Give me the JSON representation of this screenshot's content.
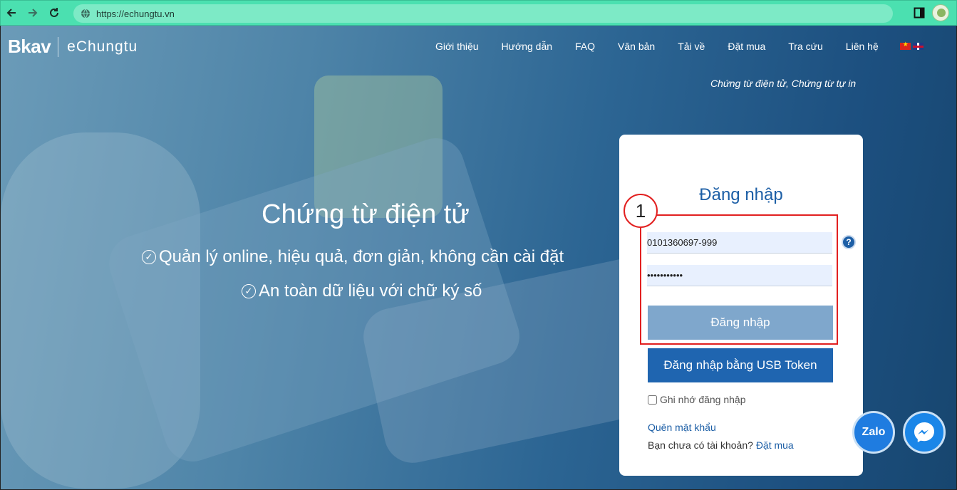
{
  "browser": {
    "url": "https://echungtu.vn",
    "icons": [
      "back-arrow-icon",
      "forward-arrow-icon",
      "reload-icon",
      "site-info-icon",
      "side-panel-icon",
      "profile-avatar"
    ]
  },
  "header": {
    "logo_brand": "Bkav",
    "logo_product": "eChungtu",
    "menu": [
      "Giới thiệu",
      "Hướng dẫn",
      "FAQ",
      "Văn bản",
      "Tải về",
      "Đặt mua",
      "Tra cứu",
      "Liên hệ"
    ],
    "tagline": "Chứng từ điện tử, Chứng từ tự in"
  },
  "hero": {
    "title": "Chứng từ điện tử",
    "features": [
      "Quản lý online, hiệu quả, đơn giản, không cần cài đặt",
      "An toàn dữ liệu với chữ ký số"
    ]
  },
  "login": {
    "title": "Đăng nhập",
    "step_number": "1",
    "username_value": "0101360697-999",
    "password_value": "•••••••••••",
    "help_label": "?",
    "login_button": "Đăng nhập",
    "usb_button": "Đăng nhập bằng USB Token",
    "remember_label": "Ghi nhớ đăng nhập",
    "forgot_link": "Quên mật khẩu",
    "signup_prompt": "Bạn chưa có tài khoản?",
    "signup_link": "Đặt mua"
  },
  "floating": {
    "zalo_label": "Zalo"
  },
  "colors": {
    "chrome": "#4be0b0",
    "primary": "#1f65b0",
    "highlight": "#e22020"
  }
}
